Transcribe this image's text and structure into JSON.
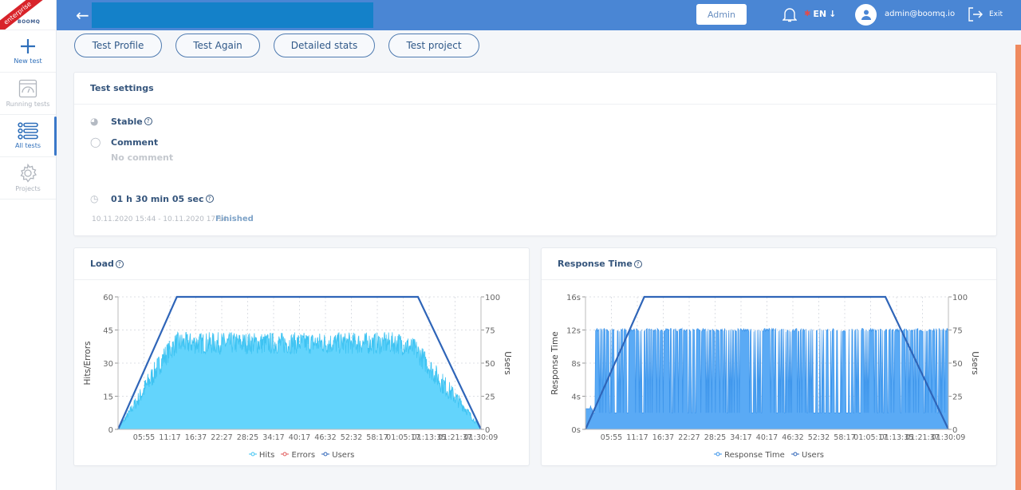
{
  "sidebar": {
    "logo": {
      "ribbon": "enterprise",
      "brand": "BOOMQ"
    },
    "items": [
      {
        "label": "New test",
        "icon": "plus-icon"
      },
      {
        "label": "Running tests",
        "icon": "gauge-icon"
      },
      {
        "label": "All tests",
        "icon": "list-icon"
      },
      {
        "label": "Projects",
        "icon": "gear-icon"
      }
    ]
  },
  "topbar": {
    "back_icon": "arrow-left-icon",
    "admin_label": "Admin",
    "language": "EN",
    "language_arrow": "↓",
    "user_email": "admin@boomq.io",
    "exit_label": "Exit"
  },
  "actions": [
    "Test Profile",
    "Test Again",
    "Detailed stats",
    "Test project"
  ],
  "settings": {
    "title": "Test settings",
    "type_label": "Stable",
    "comment_label": "Comment",
    "comment_value": "No comment",
    "duration": "01 h 30 min 05 sec",
    "date_range": "10.11.2020 15:44 - 10.11.2020 17:14",
    "status": "Finished"
  },
  "colors": {
    "topbar": "#4a86d4",
    "hits": "#3ec3f2",
    "hits_fill": "#63d4fc",
    "errors": "#e05a5a",
    "users": "#2f65b8",
    "response": "#3a93ea",
    "response_fill": "#5aaaf5",
    "accent": "#ef8a5f"
  },
  "chart_data": [
    {
      "type": "area",
      "title": "Load",
      "ylabel": "Hits/Errors",
      "y2label": "Users",
      "ylim": [
        0,
        60
      ],
      "y2lim": [
        0,
        100
      ],
      "yticks": [
        "0",
        "15",
        "30",
        "45",
        "60"
      ],
      "y2ticks": [
        "0",
        "25",
        "50",
        "75",
        "100"
      ],
      "xticks": [
        "05:55",
        "11:17",
        "16:37",
        "22:27",
        "28:25",
        "34:17",
        "40:17",
        "46:32",
        "52:32",
        "58:17",
        "01:05:17",
        "01:13:35",
        "01:21:37",
        "01:30:09"
      ],
      "duration_min": 90.15,
      "grid": true,
      "legend": [
        "Hits",
        "Errors",
        "Users"
      ],
      "legend_position": "bottom",
      "series": [
        {
          "name": "Users",
          "axis": "right",
          "points": [
            [
              0,
              0
            ],
            [
              14.6,
              100
            ],
            [
              74.5,
              100
            ],
            [
              90.15,
              0
            ]
          ]
        },
        {
          "name": "Hits",
          "axis": "left",
          "profile": [
            [
              0,
              0
            ],
            [
              5.5,
              15
            ],
            [
              11.5,
              33
            ],
            [
              14.5,
              39
            ],
            [
              70,
              39
            ],
            [
              74,
              36
            ],
            [
              80,
              22
            ],
            [
              86,
              10
            ],
            [
              90.15,
              0
            ]
          ],
          "noise_amplitude": 5,
          "peak": 50
        },
        {
          "name": "Errors",
          "axis": "left",
          "points": [
            [
              0,
              0
            ],
            [
              90.15,
              0
            ]
          ]
        }
      ]
    },
    {
      "type": "area",
      "title": "Response Time",
      "ylabel": "Response Time",
      "y2label": "Users",
      "ylim": [
        0,
        16
      ],
      "y2lim": [
        0,
        100
      ],
      "yticks": [
        "0s",
        "4s",
        "8s",
        "12s",
        "16s"
      ],
      "y2ticks": [
        "0",
        "25",
        "50",
        "75",
        "100"
      ],
      "xticks": [
        "05:55",
        "11:17",
        "16:37",
        "22:27",
        "28:25",
        "34:17",
        "40:17",
        "46:32",
        "52:32",
        "58:17",
        "01:05:17",
        "01:13:35",
        "01:21:37",
        "01:30:09"
      ],
      "duration_min": 90.15,
      "grid": true,
      "legend": [
        "Response Time",
        "Users"
      ],
      "legend_position": "bottom",
      "series": [
        {
          "name": "Users",
          "axis": "right",
          "points": [
            [
              0,
              0
            ],
            [
              14.6,
              100
            ],
            [
              74.5,
              100
            ],
            [
              90.15,
              0
            ]
          ]
        },
        {
          "name": "Response Time",
          "axis": "left",
          "high_s": 12.2,
          "low_s": 2.0,
          "initial_s": 2.5
        }
      ]
    }
  ]
}
